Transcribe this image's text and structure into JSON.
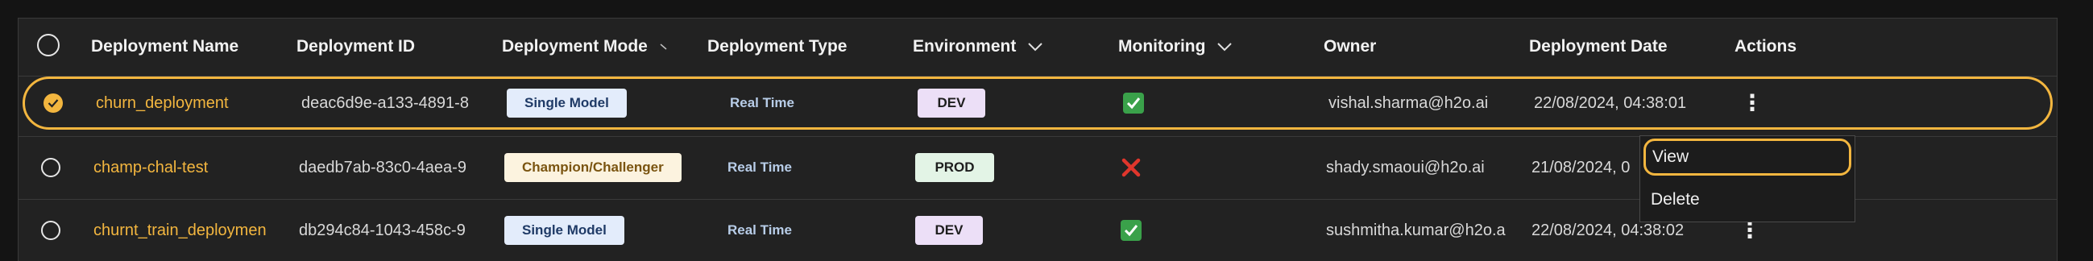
{
  "colors": {
    "accent": "#f3b63f",
    "background": "#141414",
    "panel": "#222222"
  },
  "header": {
    "columns": [
      "Deployment Name",
      "Deployment ID",
      "Deployment Mode",
      "Deployment Type",
      "Environment",
      "Monitoring",
      "Owner",
      "Deployment Date",
      "Actions"
    ],
    "select_all_checked": false
  },
  "rows": [
    {
      "selected": true,
      "name": "churn_deployment",
      "id": "deac6d9e-a133-4891-8",
      "mode": "Single Model",
      "type": "Real Time",
      "environment": "DEV",
      "monitoring": "check-icon",
      "owner": "vishal.sharma@h2o.ai",
      "date": "22/08/2024, 04:38:01"
    },
    {
      "selected": false,
      "name": "champ-chal-test",
      "id": "daedb7ab-83c0-4aea-9",
      "mode": "Champion/Challenger",
      "type": "Real Time",
      "environment": "PROD",
      "monitoring": "cross-icon",
      "owner": "shady.smaoui@h2o.ai",
      "date": "21/08/2024, 0"
    },
    {
      "selected": false,
      "name": "churnt_train_deploymen",
      "id": "db294c84-1043-458c-9",
      "mode": "Single Model",
      "type": "Real Time",
      "environment": "DEV",
      "monitoring": "check-icon",
      "owner": "sushmitha.kumar@h2o.a",
      "date": "22/08/2024, 04:38:02"
    }
  ],
  "actions_menu": {
    "items": [
      "View",
      "Delete"
    ],
    "highlighted": "View"
  }
}
